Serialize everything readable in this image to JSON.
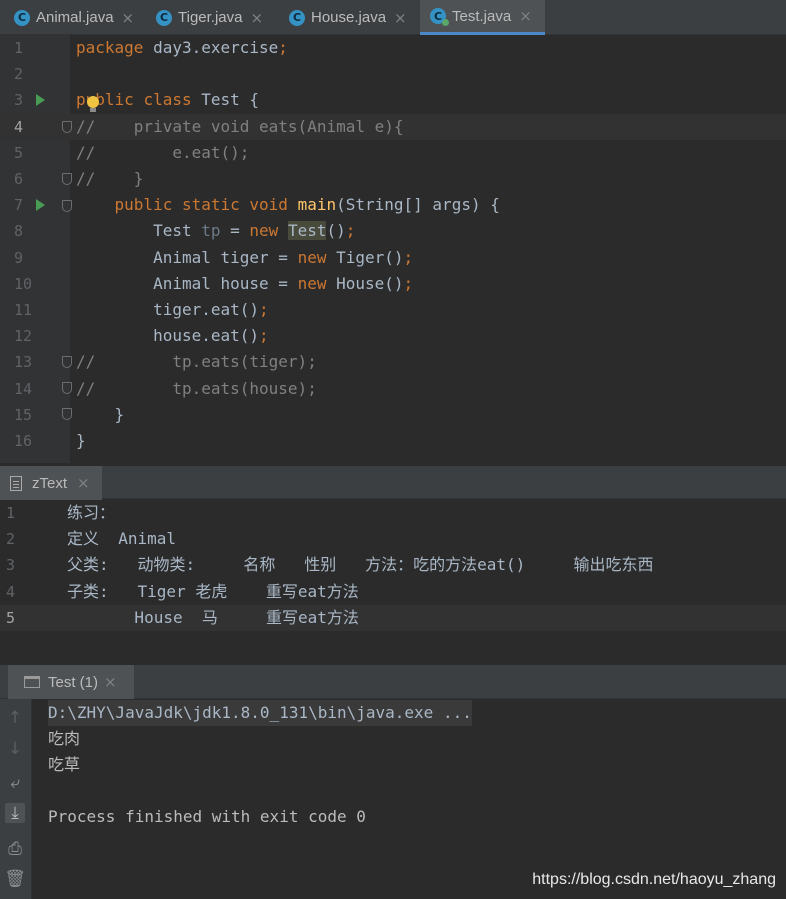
{
  "tabs": [
    {
      "icon": "C",
      "label": "Animal.java",
      "close": "×",
      "active": false
    },
    {
      "icon": "C",
      "label": "Tiger.java",
      "close": "×",
      "active": false
    },
    {
      "icon": "C",
      "label": "House.java",
      "close": "×",
      "active": false
    },
    {
      "icon": "C",
      "label": "Test.java",
      "close": "×",
      "active": true
    }
  ],
  "editor": {
    "caret_line": 4,
    "highlighted_symbol": "Test",
    "lines": [
      {
        "n": "1",
        "segs": [
          [
            "kw",
            "package "
          ],
          [
            "",
            "day3.exercise"
          ],
          [
            "kw",
            ";"
          ]
        ]
      },
      {
        "n": "2",
        "segs": []
      },
      {
        "n": "3",
        "segs": [
          [
            "kw",
            "public "
          ],
          [
            "kw",
            "class "
          ],
          [
            "",
            "Test {"
          ]
        ]
      },
      {
        "n": "4",
        "segs": [
          [
            "cm",
            "//    private void eats(Animal e){"
          ]
        ]
      },
      {
        "n": "5",
        "segs": [
          [
            "cm",
            "//        e.eat();"
          ]
        ]
      },
      {
        "n": "6",
        "segs": [
          [
            "cm",
            "//    }"
          ]
        ]
      },
      {
        "n": "7",
        "segs": [
          [
            "",
            "    "
          ],
          [
            "kw",
            "public static void "
          ],
          [
            "fn",
            "main"
          ],
          [
            "",
            "(String[] args) {"
          ]
        ]
      },
      {
        "n": "8",
        "segs": [
          [
            "",
            "        Test "
          ],
          [
            "dim",
            "tp"
          ],
          [
            "",
            " = "
          ],
          [
            "kw",
            "new "
          ],
          [
            "hl",
            "Test"
          ],
          [
            "",
            "()"
          ],
          [
            "kw",
            ";"
          ]
        ]
      },
      {
        "n": "9",
        "segs": [
          [
            "",
            "        Animal tiger = "
          ],
          [
            "kw",
            "new "
          ],
          [
            "",
            "Tiger()"
          ],
          [
            "kw",
            ";"
          ]
        ]
      },
      {
        "n": "10",
        "segs": [
          [
            "",
            "        Animal house = "
          ],
          [
            "kw",
            "new "
          ],
          [
            "",
            "House()"
          ],
          [
            "kw",
            ";"
          ]
        ]
      },
      {
        "n": "11",
        "segs": [
          [
            "",
            "        tiger.eat()"
          ],
          [
            "kw",
            ";"
          ]
        ]
      },
      {
        "n": "12",
        "segs": [
          [
            "",
            "        house.eat()"
          ],
          [
            "kw",
            ";"
          ]
        ]
      },
      {
        "n": "13",
        "segs": [
          [
            "cm",
            "//        tp.eats(tiger);"
          ]
        ]
      },
      {
        "n": "14",
        "segs": [
          [
            "cm",
            "//        tp.eats(house);"
          ]
        ]
      },
      {
        "n": "15",
        "segs": [
          [
            "",
            "    }"
          ]
        ]
      },
      {
        "n": "16",
        "segs": [
          [
            "",
            "}"
          ]
        ]
      }
    ]
  },
  "ztext": {
    "tab_label": "zText",
    "close": "×",
    "caret_line": 5,
    "lines": [
      {
        "n": "1",
        "text": "练习："
      },
      {
        "n": "2",
        "text": "定义  Animal"
      },
      {
        "n": "3",
        "text": "父类:   动物类:     名称   性别   方法：吃的方法eat()     输出吃东西"
      },
      {
        "n": "4",
        "text": "子类:   Tiger 老虎    重写eat方法"
      },
      {
        "n": "5",
        "text": "       House  马     重写eat方法"
      }
    ]
  },
  "run": {
    "tab_label": "Test (1)",
    "close": "×",
    "tools": [
      {
        "name": "up-arrow-icon",
        "glyph": "↑",
        "state": "disabled"
      },
      {
        "name": "down-arrow-icon",
        "glyph": "↓",
        "state": "disabled"
      },
      {
        "name": "soft-wrap-icon",
        "glyph": "⤶",
        "state": "normal"
      },
      {
        "name": "scroll-to-end-icon",
        "glyph": "⤓",
        "state": "active"
      },
      {
        "name": "print-icon",
        "glyph": "⎙",
        "state": "normal"
      },
      {
        "name": "trash-icon",
        "glyph": "🗑",
        "state": "normal"
      }
    ],
    "console": [
      "D:\\ZHY\\JavaJdk\\jdk1.8.0_131\\bin\\java.exe ...",
      "吃肉",
      "吃草",
      "",
      "Process finished with exit code 0"
    ]
  },
  "watermark": "https://blog.csdn.net/haoyu_zhang"
}
